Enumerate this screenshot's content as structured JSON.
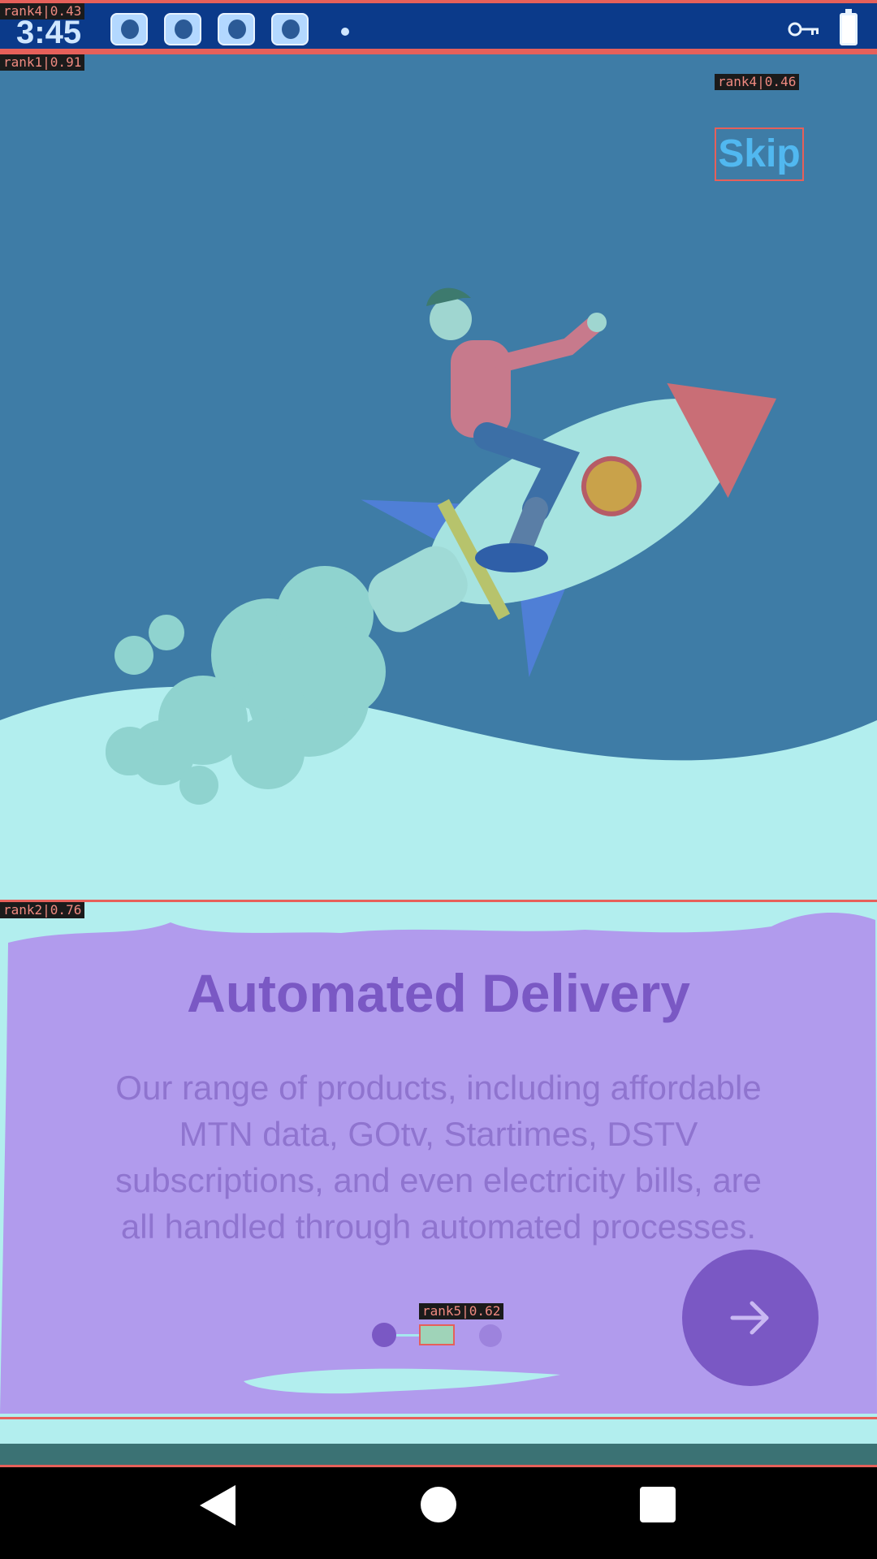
{
  "status_bar": {
    "time": "3:45",
    "overlay_label": "rank4|0.43",
    "notification_icons": [
      "app-notification-icon",
      "app-notification-icon",
      "app-notification-icon",
      "app-notification-icon"
    ],
    "icons": [
      "key-icon",
      "battery-charging-icon"
    ]
  },
  "hero": {
    "overlay_label": "rank1|0.91",
    "skip_overlay_label": "rank4|0.46",
    "skip_label": "Skip",
    "illustration": "person-riding-rocket-illustration"
  },
  "card": {
    "overlay_label": "rank2|0.76",
    "title": "Automated Delivery",
    "body": "Our range of products, including affordable MTN data, GOtv, Startimes, DSTV subscriptions, and even electricity bills, are all handled through automated processes.",
    "pager_overlay_label": "rank5|0.62",
    "pager": {
      "count": 3,
      "current": 2
    },
    "next_icon": "arrow-right-icon"
  },
  "nav_bar": {
    "icons": [
      "back-icon",
      "home-icon",
      "recent-apps-icon"
    ]
  },
  "colors": {
    "hero_bg": "#3e7ca6",
    "accent": "#7a58c4",
    "card_bg": "#b19bed",
    "mint": "#b2eeee"
  }
}
